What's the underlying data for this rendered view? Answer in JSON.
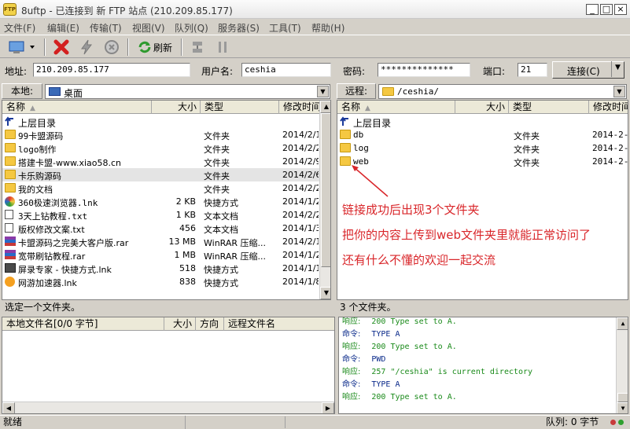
{
  "window": {
    "title": "8uftp - 已连接到 新 FTP 站点 (210.209.85.177)",
    "icon_label": "FTP",
    "min": "_",
    "max": "□",
    "close": "×"
  },
  "menu": [
    "文件(F)",
    "编辑(E)",
    "传输(T)",
    "视图(V)",
    "队列(Q)",
    "服务器(S)",
    "工具(T)",
    "帮助(H)"
  ],
  "toolbar": {
    "refresh_label": "刷新"
  },
  "address": {
    "addr_label": "地址:",
    "addr_value": "210.209.85.177",
    "user_label": "用户名:",
    "user_value": "ceshia",
    "pass_label": "密码:",
    "pass_value": "**************",
    "port_label": "端口:",
    "port_value": "21",
    "connect_label": "连接(C)"
  },
  "local": {
    "label": "本地:",
    "path": "桌面",
    "columns": [
      "名称",
      "大小",
      "类型",
      "修改时间"
    ],
    "up": "上层目录",
    "files": [
      {
        "name": "99卡盟源码",
        "size": "",
        "type": "文件夹",
        "date": "2014/2/1",
        "icon": "folder"
      },
      {
        "name": "logo制作",
        "size": "",
        "type": "文件夹",
        "date": "2014/2/2",
        "icon": "folder"
      },
      {
        "name": "搭建卡盟-www.xiao58.cn",
        "size": "",
        "type": "文件夹",
        "date": "2014/2/9",
        "icon": "folder"
      },
      {
        "name": "卡乐购源码",
        "size": "",
        "type": "文件夹",
        "date": "2014/2/6",
        "icon": "folder"
      },
      {
        "name": "我的文档",
        "size": "",
        "type": "文件夹",
        "date": "2014/2/2",
        "icon": "folder"
      },
      {
        "name": "360极速浏览器.lnk",
        "size": "2 KB",
        "type": "快捷方式",
        "date": "2014/1/2",
        "icon": "browser"
      },
      {
        "name": "3天上钻教程.txt",
        "size": "1 KB",
        "type": "文本文档",
        "date": "2014/2/2",
        "icon": "txt"
      },
      {
        "name": "版权修改文案.txt",
        "size": "456",
        "type": "文本文档",
        "date": "2014/1/3",
        "icon": "txt"
      },
      {
        "name": "卡盟源码之完美大客户版.rar",
        "size": "13 MB",
        "type": "WinRAR 压缩...",
        "date": "2014/2/1",
        "icon": "rar"
      },
      {
        "name": "宽带刷钻教程.rar",
        "size": "1 MB",
        "type": "WinRAR 压缩...",
        "date": "2014/1/2",
        "icon": "rar"
      },
      {
        "name": "屏录专家 - 快捷方式.lnk",
        "size": "518",
        "type": "快捷方式",
        "date": "2014/1/1",
        "icon": "screen"
      },
      {
        "name": "网游加速器.lnk",
        "size": "838",
        "type": "快捷方式",
        "date": "2014/1/8",
        "icon": "game"
      }
    ],
    "status": "选定一个文件夹。"
  },
  "remote": {
    "label": "远程:",
    "path": "/ceshia/",
    "columns": [
      "名称",
      "大小",
      "类型",
      "修改时间"
    ],
    "up": "上层目录",
    "files": [
      {
        "name": "db",
        "type": "文件夹",
        "date": "2014-2-2"
      },
      {
        "name": "log",
        "type": "文件夹",
        "date": "2014-2-2"
      },
      {
        "name": "web",
        "type": "文件夹",
        "date": "2014-2-2"
      }
    ],
    "status": "3 个文件夹。"
  },
  "annotations": [
    "链接成功后出现3个文件夹",
    "把你的内容上传到web文件夹里就能正常访问了",
    "还有什么不懂的欢迎一起交流"
  ],
  "queue": {
    "columns": [
      "本地文件名[0/0 字节]",
      "大小",
      "方向",
      "远程文件名"
    ]
  },
  "log": [
    {
      "k": "响应:",
      "v": "200 Type set to A.",
      "c": "#1a8a1a"
    },
    {
      "k": "命令:",
      "v": "TYPE A",
      "c": "#0a2a8a"
    },
    {
      "k": "响应:",
      "v": "200 Type set to A.",
      "c": "#1a8a1a"
    },
    {
      "k": "命令:",
      "v": "PWD",
      "c": "#0a2a8a"
    },
    {
      "k": "响应:",
      "v": "257 \"/ceshia\" is current directory",
      "c": "#1a8a1a"
    },
    {
      "k": "命令:",
      "v": "TYPE A",
      "c": "#0a2a8a"
    },
    {
      "k": "响应:",
      "v": "200 Type set to A.",
      "c": "#1a8a1a"
    }
  ],
  "statusbar": {
    "left": "就绪",
    "queue": "队列: 0 字节"
  }
}
